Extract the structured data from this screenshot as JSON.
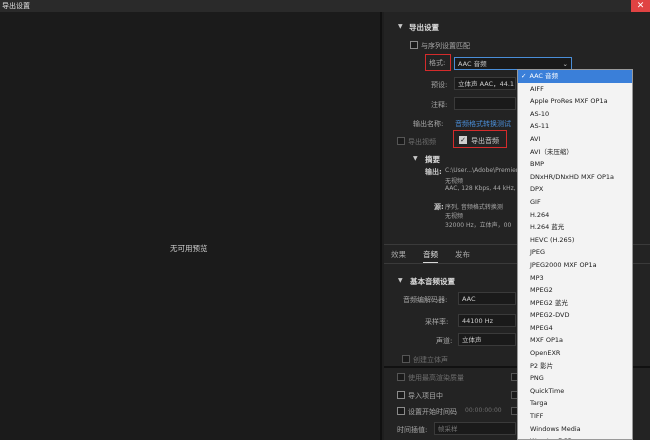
{
  "window": {
    "title": "导出设置",
    "close_glyph": "✕"
  },
  "preview": {
    "empty_text": "无可用预览"
  },
  "export_settings": {
    "section_title": "导出设置",
    "match_sequence_label": "与序列设置匹配",
    "format_label": "格式:",
    "format_value": "AAC 音频",
    "preset_label": "预设:",
    "preset_value": "立体声 AAC，44.1",
    "comment_label": "注释:",
    "output_name_label": "输出名称:",
    "output_name_value": "音频格式转换测试",
    "export_video_label": "导出视频",
    "export_audio_label": "导出音频",
    "summary_title": "摘要",
    "output_key": "输出:",
    "output_lines": [
      "C:\\User...\\Adobe\\Premiere",
      "无视频",
      "AAC, 128 Kbps, 44  kHz,"
    ],
    "source_key": "源:",
    "source_lines": [
      "序列, 音频格式转换测",
      "无视频",
      "32000 Hz，立体声，00"
    ]
  },
  "tabs": [
    {
      "label": "效果"
    },
    {
      "label": "音频"
    },
    {
      "label": "发布"
    }
  ],
  "audio": {
    "section_title": "基本音频设置",
    "codec_label": "音频编解码器:",
    "codec_value": "AAC",
    "sample_rate_label": "采样率:",
    "sample_rate_value": "44100 Hz",
    "channels_label": "声道:",
    "channels_value": "立体声",
    "create_stereo_label": "创建立体声"
  },
  "bottom": {
    "max_render_label": "使用最高渲染质量",
    "import_project_label": "导入项目中",
    "set_start_tc_label": "设置开始时间码",
    "start_tc_value": "00:00:00:00",
    "time_interp_label": "时间插值:",
    "time_interp_value": "帧采样"
  },
  "format_dropdown": {
    "selected_mark": "✓",
    "options": [
      "AAC 音频",
      "AIFF",
      "Apple ProRes MXF OP1a",
      "AS-10",
      "AS-11",
      "AVI",
      "AVI（未压缩）",
      "BMP",
      "DNxHR/DNxHD MXF OP1a",
      "DPX",
      "GIF",
      "H.264",
      "H.264 蓝光",
      "HEVC (H.265)",
      "JPEG",
      "JPEG2000 MXF OP1a",
      "MP3",
      "MPEG2",
      "MPEG2 蓝光",
      "MPEG2-DVD",
      "MPEG4",
      "MXF OP1a",
      "OpenEXR",
      "P2 影片",
      "PNG",
      "QuickTime",
      "Targa",
      "TIFF",
      "Windows Media",
      "Wraptor DCP"
    ]
  },
  "colors": {
    "accent_link": "#4a8ed8",
    "highlight_box": "#d42b2b",
    "selection": "#3a7fd9"
  }
}
